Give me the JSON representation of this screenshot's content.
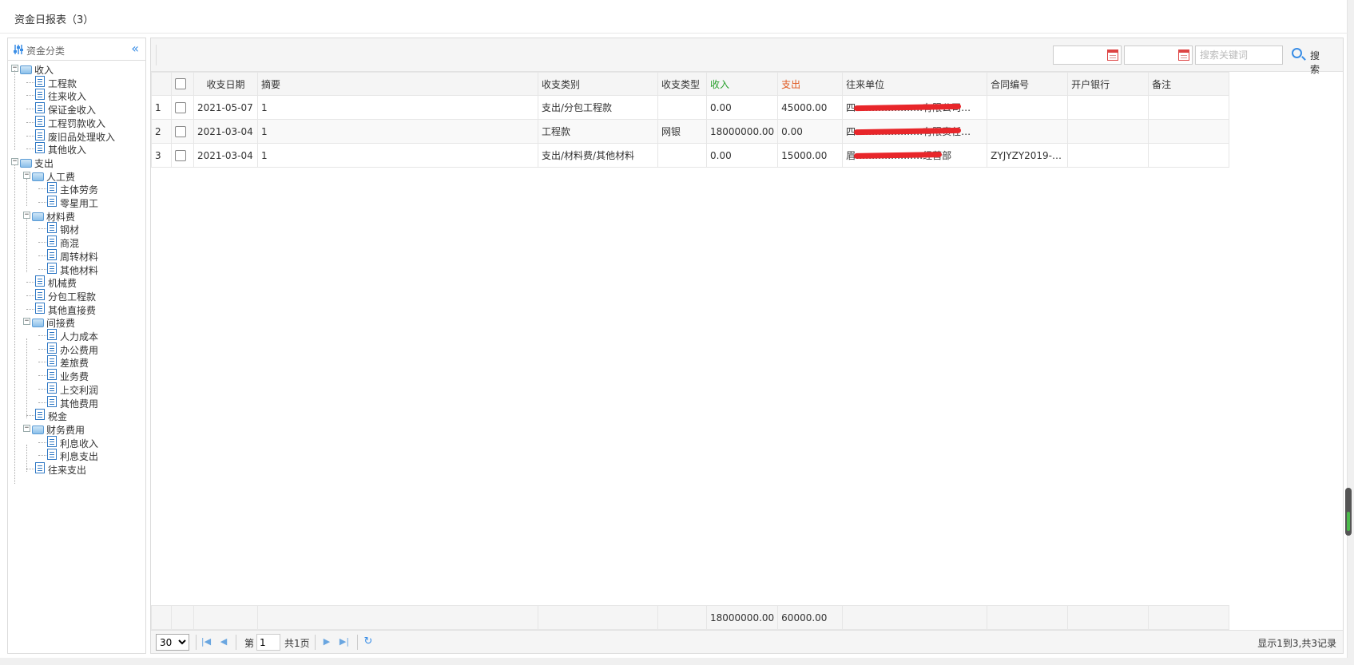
{
  "title": "资金日报表（3）",
  "sidebar": {
    "title": "资金分类",
    "collapse_icon": "«",
    "nodes": [
      {
        "label": "收入",
        "type": "folder"
      },
      {
        "label": "工程款",
        "type": "doc"
      },
      {
        "label": "往来收入",
        "type": "doc"
      },
      {
        "label": "保证金收入",
        "type": "doc"
      },
      {
        "label": "工程罚款收入",
        "type": "doc"
      },
      {
        "label": "废旧品处理收入",
        "type": "doc"
      },
      {
        "label": "其他收入",
        "type": "doc"
      },
      {
        "label": "支出",
        "type": "folder"
      },
      {
        "label": "人工费",
        "type": "folder"
      },
      {
        "label": "主体劳务",
        "type": "doc"
      },
      {
        "label": "零星用工",
        "type": "doc"
      },
      {
        "label": "材料费",
        "type": "folder"
      },
      {
        "label": "钢材",
        "type": "doc"
      },
      {
        "label": "商混",
        "type": "doc"
      },
      {
        "label": "周转材料",
        "type": "doc"
      },
      {
        "label": "其他材料",
        "type": "doc"
      },
      {
        "label": "机械费",
        "type": "doc"
      },
      {
        "label": "分包工程款",
        "type": "doc"
      },
      {
        "label": "其他直接费",
        "type": "doc"
      },
      {
        "label": "间接费",
        "type": "folder"
      },
      {
        "label": "人力成本",
        "type": "doc"
      },
      {
        "label": "办公费用",
        "type": "doc"
      },
      {
        "label": "差旅费",
        "type": "doc"
      },
      {
        "label": "业务费",
        "type": "doc"
      },
      {
        "label": "上交利润",
        "type": "doc"
      },
      {
        "label": "其他费用",
        "type": "doc"
      },
      {
        "label": "税金",
        "type": "doc"
      },
      {
        "label": "财务费用",
        "type": "folder"
      },
      {
        "label": "利息收入",
        "type": "doc"
      },
      {
        "label": "利息支出",
        "type": "doc"
      },
      {
        "label": "往来支出",
        "type": "doc"
      }
    ]
  },
  "toolbar": {
    "search_placeholder": "搜索关键词",
    "search_label": "搜索"
  },
  "table": {
    "columns": [
      "收支日期",
      "摘要",
      "收支类别",
      "收支类型",
      "收入",
      "支出",
      "往来单位",
      "合同编号",
      "开户银行",
      "备注"
    ],
    "rows": [
      {
        "no": "1",
        "date": "2021-05-07",
        "summary": "1",
        "category": "支出/分包工程款",
        "type": "",
        "income": "0.00",
        "expense": "45000.00",
        "unit": "四…………………有限公司…",
        "contract": "",
        "bank": "",
        "note": ""
      },
      {
        "no": "2",
        "date": "2021-03-04",
        "summary": "1",
        "category": "工程款",
        "type": "网银",
        "income": "18000000.00",
        "expense": "0.00",
        "unit": "四…………………有限责任…",
        "contract": "",
        "bank": "",
        "note": ""
      },
      {
        "no": "3",
        "date": "2021-03-04",
        "summary": "1",
        "category": "支出/材料费/其他材料",
        "type": "",
        "income": "0.00",
        "expense": "15000.00",
        "unit": "眉…………………经营部",
        "contract": "ZYJYZY2019-…",
        "bank": "",
        "note": ""
      }
    ],
    "totals": {
      "income": "18000000.00",
      "expense": "60000.00"
    }
  },
  "pager": {
    "page_size": "30",
    "page_prefix": "第",
    "page_value": "1",
    "page_suffix": "共1页",
    "info": "显示1到3,共3记录"
  },
  "colors": {
    "income_header": "#28a02d",
    "expense_header": "#e0581f",
    "accent": "#3a8ee6"
  }
}
